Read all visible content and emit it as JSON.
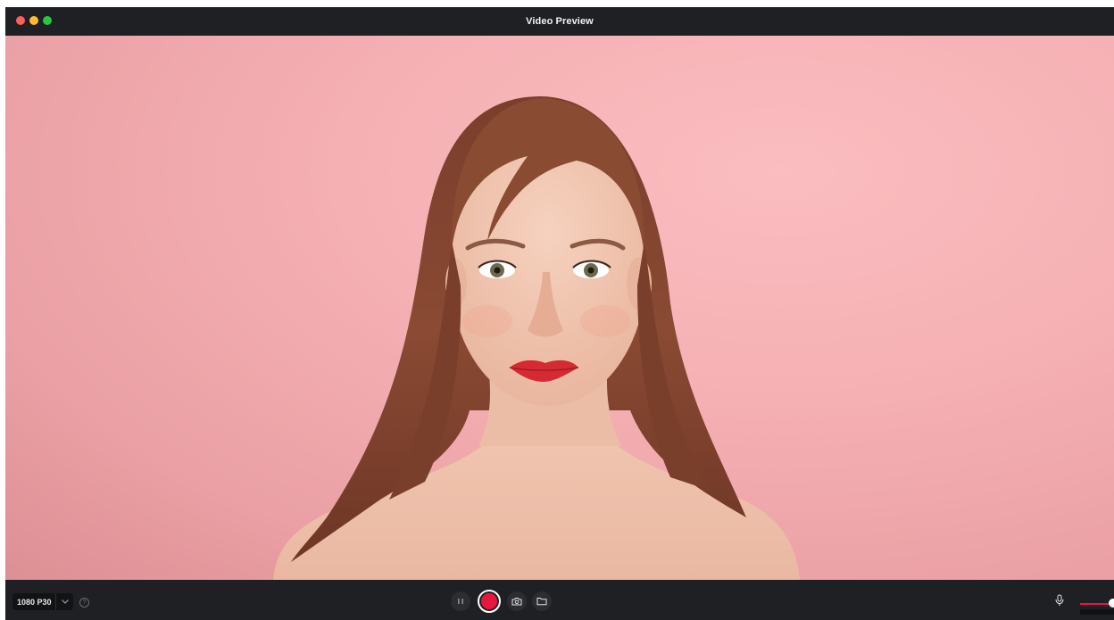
{
  "window": {
    "title": "Video Preview",
    "traffic_lights": [
      "close",
      "minimize",
      "maximize"
    ]
  },
  "preview": {
    "content": "webcam-video-frame"
  },
  "toolbar": {
    "resolution": {
      "selected": "1080 P30",
      "icon": "chevron-down-icon"
    },
    "help_icon": "question-circle-icon",
    "controls": [
      {
        "name": "pause",
        "icon": "pause-icon"
      },
      {
        "name": "record",
        "icon": "record-icon",
        "color": "#e8173a"
      },
      {
        "name": "snapshot",
        "icon": "camera-icon"
      },
      {
        "name": "open-folder",
        "icon": "folder-icon"
      }
    ],
    "microphone": {
      "icon": "microphone-icon",
      "volume": 0.9
    }
  },
  "colors": {
    "chrome": "#1f2023",
    "record": "#e8173a",
    "background": "#f5b0b3"
  }
}
